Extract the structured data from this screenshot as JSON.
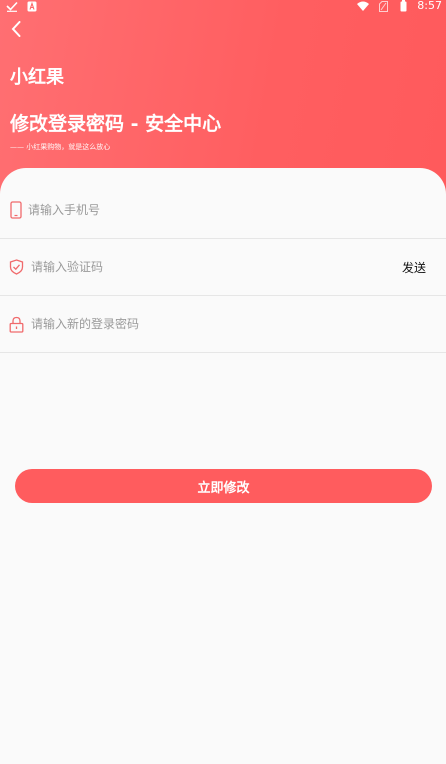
{
  "status_bar": {
    "time": "8:57",
    "left_icons": [
      "check-icon",
      "a-badge-icon"
    ],
    "right_icons": [
      "wifi-icon",
      "sim-icon",
      "battery-icon"
    ]
  },
  "header": {
    "back_icon": "chevron-left-icon",
    "app_title": "小红果",
    "page_title": "修改登录密码 - 安全中心",
    "slogan": "—— 小红果购物，就是这么放心",
    "gradient_colors": [
      "#ff6f72",
      "#ff5a5c"
    ]
  },
  "form": {
    "phone": {
      "icon": "phone-icon",
      "placeholder": "请输入手机号",
      "value": ""
    },
    "code": {
      "icon": "shield-check-icon",
      "placeholder": "请输入验证码",
      "value": "",
      "send_label": "发送"
    },
    "password": {
      "icon": "lock-icon",
      "placeholder": "请输入新的登录密码",
      "value": ""
    },
    "submit_label": "立即修改"
  },
  "colors": {
    "accent": "#ff5c5e",
    "icon_accent": "#f06a6c",
    "divider": "#e6e6e6",
    "background": "#fafafa"
  }
}
